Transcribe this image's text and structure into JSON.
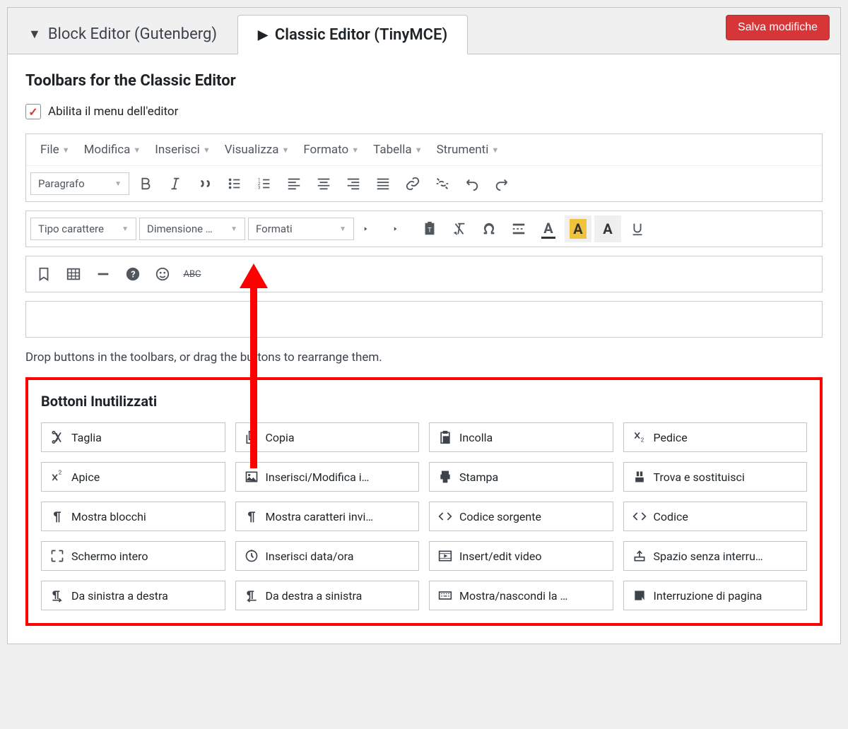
{
  "save_button": "Salva modifiche",
  "tabs": {
    "block": "Block Editor (Gutenberg)",
    "classic": "Classic Editor (TinyMCE)"
  },
  "section_title": "Toolbars for the Classic Editor",
  "enable_menu": "Abilita il menu dell'editor",
  "menu": [
    "File",
    "Modifica",
    "Inserisci",
    "Visualizza",
    "Formato",
    "Tabella",
    "Strumenti"
  ],
  "dropdowns": {
    "paragraph": "Paragrafo",
    "font": "Tipo carattere",
    "size": "Dimensione …",
    "formats": "Formati"
  },
  "help_text": "Drop buttons in the toolbars, or drag the buttons to rearrange them.",
  "unused_title": "Bottoni Inutilizzati",
  "unused": [
    {
      "k": "cut",
      "l": "Taglia"
    },
    {
      "k": "copy",
      "l": "Copia"
    },
    {
      "k": "paste",
      "l": "Incolla"
    },
    {
      "k": "sub",
      "l": "Pedice"
    },
    {
      "k": "sup",
      "l": "Apice"
    },
    {
      "k": "img",
      "l": "Inserisci/Modifica i…"
    },
    {
      "k": "print",
      "l": "Stampa"
    },
    {
      "k": "find",
      "l": "Trova e sostituisci"
    },
    {
      "k": "blocks",
      "l": "Mostra blocchi"
    },
    {
      "k": "invis",
      "l": "Mostra caratteri invi…"
    },
    {
      "k": "source",
      "l": "Codice sorgente"
    },
    {
      "k": "code",
      "l": "Codice"
    },
    {
      "k": "full",
      "l": "Schermo intero"
    },
    {
      "k": "date",
      "l": "Inserisci data/ora"
    },
    {
      "k": "video",
      "l": "Insert/edit video"
    },
    {
      "k": "nbsp",
      "l": "Spazio senza interru…"
    },
    {
      "k": "ltr",
      "l": "Da sinistra a destra"
    },
    {
      "k": "rtl",
      "l": "Da destra a sinistra"
    },
    {
      "k": "kbd",
      "l": "Mostra/nascondi la …"
    },
    {
      "k": "break",
      "l": "Interruzione di pagina"
    }
  ]
}
